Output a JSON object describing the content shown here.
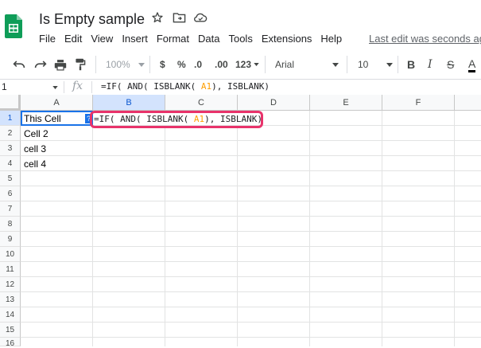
{
  "header": {
    "title": "Is Empty sample",
    "menu": [
      "File",
      "Edit",
      "View",
      "Insert",
      "Format",
      "Data",
      "Tools",
      "Extensions",
      "Help"
    ],
    "last_edit": "Last edit was seconds ago"
  },
  "toolbar": {
    "zoom": "100%",
    "currency": "$",
    "percent": "%",
    "decrease_decimals": ".0",
    "increase_decimals": ".00",
    "more_formats": "123",
    "font": "Arial",
    "font_size": "10",
    "bold": "B",
    "italic": "I",
    "strikethrough": "S",
    "text_color": "A"
  },
  "formula_bar": {
    "name_box": "1",
    "fx": "fx",
    "formula_prefix": "=IF( AND( ISBLANK( ",
    "formula_ref": "A1",
    "formula_suffix": "), ISBLANK)"
  },
  "grid": {
    "columns": [
      "A",
      "B",
      "C",
      "D",
      "E",
      "F"
    ],
    "rows": [
      "1",
      "2",
      "3",
      "4",
      "5",
      "6",
      "7",
      "8",
      "9",
      "10",
      "11",
      "12",
      "13",
      "14",
      "15",
      "16"
    ],
    "cells": {
      "A1": "This Cell",
      "A2": "Cell 2",
      "A3": "cell 3",
      "A4": "cell 4"
    },
    "editor": {
      "prefix": "=IF( AND( ISBLANK( ",
      "ref": "A1",
      "suffix": "), ISBLANK)"
    },
    "handle_glyph": "?"
  },
  "colors": {
    "accent": "#1a73e8",
    "highlight": "#e8336b",
    "reference": "#ff9e00"
  }
}
